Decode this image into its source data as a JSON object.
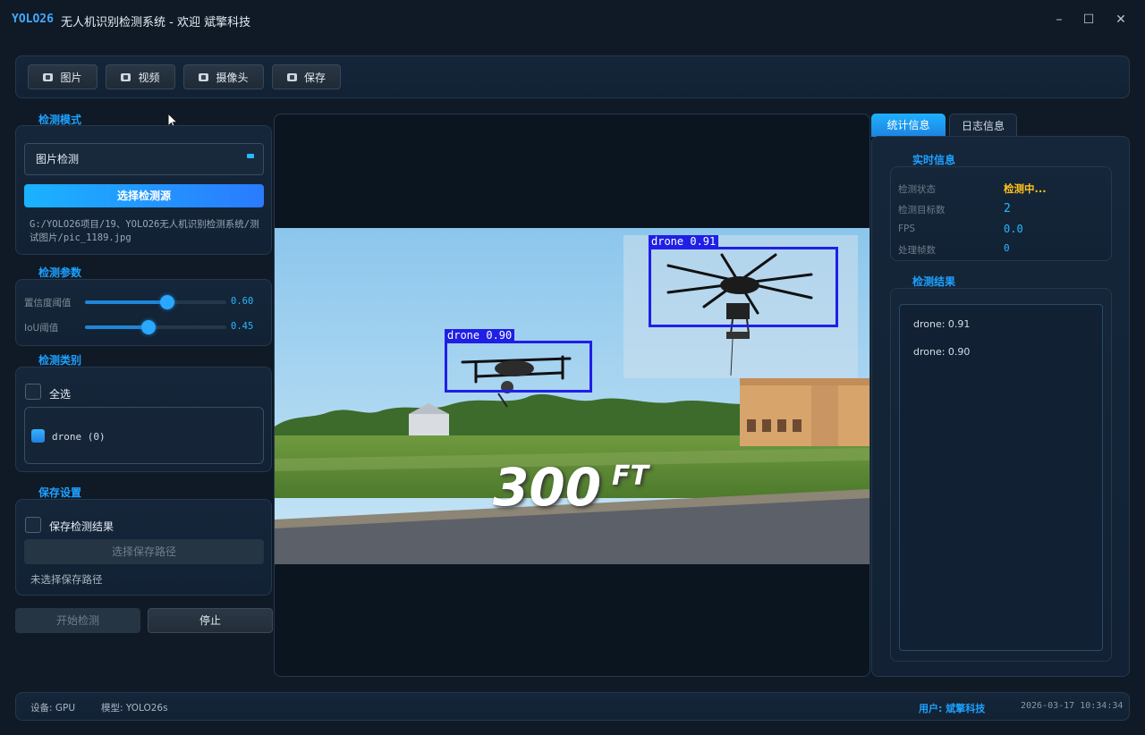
{
  "window": {
    "brand": "YOLO26",
    "title": "无人机识别检测系统 - 欢迎 斌擎科技",
    "min_icon": "minimize-icon",
    "max_icon": "maximize-icon",
    "close_icon": "close-icon"
  },
  "toolbar": {
    "buttons": [
      {
        "label": "图片",
        "icon": "image-icon"
      },
      {
        "label": "视频",
        "icon": "video-icon"
      },
      {
        "label": "摄像头",
        "icon": "camera-icon"
      },
      {
        "label": "保存",
        "icon": "save-icon"
      }
    ]
  },
  "left": {
    "mode_title": "检测模式",
    "mode_value": "图片检测",
    "select_source": "选择检测源",
    "source_path": "G:/YOLO26项目/19、YOLO26无人机识别检测系统/测试图片/pic_1189.jpg",
    "param_title": "检测参数",
    "confidence_label": "置信度阈值",
    "confidence_value": "0.60",
    "confidence_level": 0.6,
    "iou_label": "IoU阈值",
    "iou_value": "0.45",
    "iou_level": 0.45,
    "class_title": "检测类别",
    "select_all": "全选",
    "class_item": "drone (0)",
    "save_title": "保存设置",
    "save_results": "保存检测结果",
    "select_save_path": "选择保存路径",
    "no_save_path": "未选择保存路径",
    "start": "开始检测",
    "stop": "停止"
  },
  "image": {
    "detections": [
      {
        "label": "drone 0.91"
      },
      {
        "label": "drone 0.90"
      }
    ],
    "overlay_text": "300",
    "overlay_unit": "FT",
    "colors": {
      "box": "#1f1fe6",
      "label_bg": "#1f1fe6"
    }
  },
  "right": {
    "tab_stats": "统计信息",
    "tab_log": "日志信息",
    "realtime_title": "实时信息",
    "status_label": "检测状态",
    "status_value": "检测中...",
    "count_label": "检测目标数",
    "count_value": "2",
    "fps_label": "FPS",
    "fps_value": "0.0",
    "frames_label": "处理帧数",
    "frames_value": "0",
    "results_title": "检测结果",
    "results": [
      "drone: 0.91",
      "drone: 0.90"
    ]
  },
  "status": {
    "device": "设备: GPU",
    "model": "模型: YOLO26s",
    "user": "用户: 斌擎科技",
    "datetime": "2026-03-17 10:34:34"
  },
  "colors": {
    "accent": "#1da1ff",
    "warning": "#ffc21a",
    "background": "#0f1a26"
  }
}
